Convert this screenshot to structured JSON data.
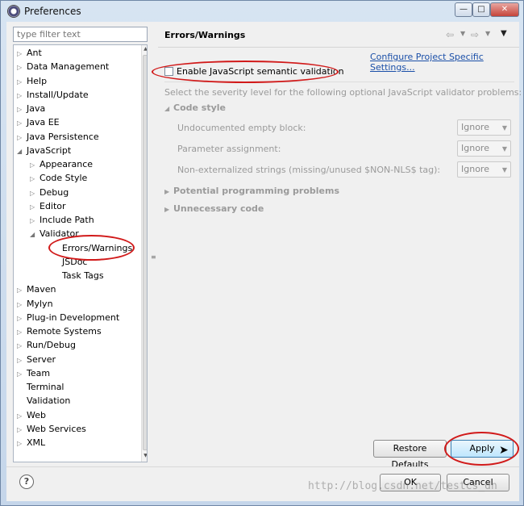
{
  "window": {
    "title": "Preferences",
    "controls": {
      "minimize": "—",
      "maximize": "□",
      "close": "✕"
    }
  },
  "filter": {
    "placeholder": "type filter text"
  },
  "tree": {
    "items": [
      {
        "label": "Ant",
        "arrow": "▷",
        "level": 0
      },
      {
        "label": "Data Management",
        "arrow": "▷",
        "level": 0
      },
      {
        "label": "Help",
        "arrow": "▷",
        "level": 0
      },
      {
        "label": "Install/Update",
        "arrow": "▷",
        "level": 0
      },
      {
        "label": "Java",
        "arrow": "▷",
        "level": 0
      },
      {
        "label": "Java EE",
        "arrow": "▷",
        "level": 0
      },
      {
        "label": "Java Persistence",
        "arrow": "▷",
        "level": 0
      },
      {
        "label": "JavaScript",
        "arrow": "◢",
        "level": 0
      },
      {
        "label": "Appearance",
        "arrow": "▷",
        "level": 1
      },
      {
        "label": "Code Style",
        "arrow": "▷",
        "level": 1
      },
      {
        "label": "Debug",
        "arrow": "▷",
        "level": 1
      },
      {
        "label": "Editor",
        "arrow": "▷",
        "level": 1
      },
      {
        "label": "Include Path",
        "arrow": "▷",
        "level": 1
      },
      {
        "label": "Validator",
        "arrow": "◢",
        "level": 1
      },
      {
        "label": "Errors/Warnings",
        "arrow": "",
        "level": 2
      },
      {
        "label": "JSDoc",
        "arrow": "",
        "level": 2
      },
      {
        "label": "Task Tags",
        "arrow": "",
        "level": 2
      },
      {
        "label": "Maven",
        "arrow": "▷",
        "level": 0
      },
      {
        "label": "Mylyn",
        "arrow": "▷",
        "level": 0
      },
      {
        "label": "Plug-in Development",
        "arrow": "▷",
        "level": 0
      },
      {
        "label": "Remote Systems",
        "arrow": "▷",
        "level": 0
      },
      {
        "label": "Run/Debug",
        "arrow": "▷",
        "level": 0
      },
      {
        "label": "Server",
        "arrow": "▷",
        "level": 0
      },
      {
        "label": "Team",
        "arrow": "▷",
        "level": 0
      },
      {
        "label": "Terminal",
        "arrow": "",
        "level": 0
      },
      {
        "label": "Validation",
        "arrow": "",
        "level": 0
      },
      {
        "label": "Web",
        "arrow": "▷",
        "level": 0
      },
      {
        "label": "Web Services",
        "arrow": "▷",
        "level": 0
      },
      {
        "label": "XML",
        "arrow": "▷",
        "level": 0
      }
    ]
  },
  "page": {
    "title": "Errors/Warnings",
    "configure_link": "Configure Project Specific Settings...",
    "enable_label": "Enable JavaScript semantic validation",
    "enable_checked": false,
    "hint": "Select the severity level for the following optional JavaScript validator problems:",
    "code_style": {
      "title": "Code style",
      "options": [
        {
          "label": "Undocumented empty block:",
          "value": "Ignore"
        },
        {
          "label": "Parameter assignment:",
          "value": "Ignore"
        },
        {
          "label": "Non-externalized strings (missing/unused $NON-NLS$ tag):",
          "value": "Ignore"
        }
      ]
    },
    "potential": {
      "title": "Potential programming problems"
    },
    "unnecessary": {
      "title": "Unnecessary code"
    },
    "buttons": {
      "restore": "Restore Defaults",
      "apply": "Apply"
    }
  },
  "footer": {
    "ok": "OK",
    "cancel": "Cancel",
    "help": "?"
  },
  "watermark": "http://blog.csdn.net/testcs_dn",
  "colors": {
    "highlight_circle": "#d11a1a",
    "link": "#1a4fa8"
  }
}
